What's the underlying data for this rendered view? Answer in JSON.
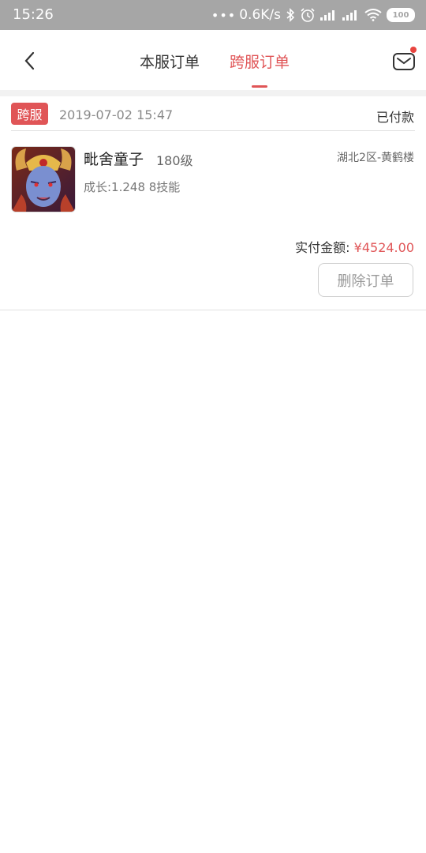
{
  "status_bar": {
    "time": "15:26",
    "network_speed": "0.6K/s",
    "battery": "100"
  },
  "header": {
    "tabs": [
      {
        "label": "本服订单",
        "active": false
      },
      {
        "label": "跨服订单",
        "active": true
      }
    ],
    "accent_color": "#e05557"
  },
  "order": {
    "tag": "跨服",
    "datetime": "2019-07-02 15:47",
    "status": "已付款",
    "character_name": "毗舍童子",
    "level": "180级",
    "server": "湖北2区-黄鹤楼",
    "growth": "成长:1.248 8技能",
    "paid_label": "实付金额:",
    "paid_amount": "¥4524.00",
    "delete_label": "删除订单"
  }
}
